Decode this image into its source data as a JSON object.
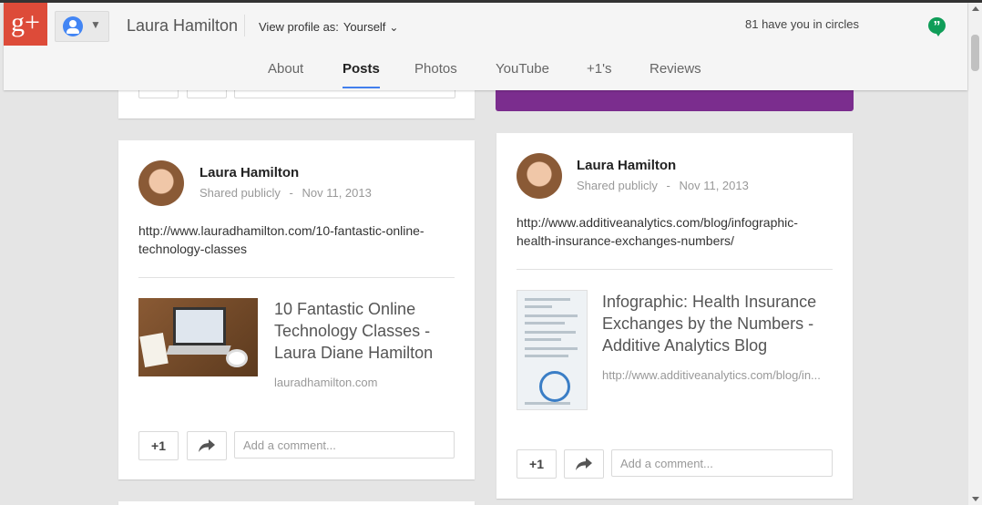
{
  "app": {
    "logo_text": "g+"
  },
  "header": {
    "profile_name": "Laura Hamilton",
    "view_profile_label": "View profile as:",
    "view_profile_value": "Yourself",
    "circles_text": "81 have you in circles"
  },
  "tabs": [
    {
      "label": "About"
    },
    {
      "label": "Posts",
      "active": true
    },
    {
      "label": "Photos"
    },
    {
      "label": "YouTube"
    },
    {
      "label": "+1's"
    },
    {
      "label": "Reviews"
    }
  ],
  "posts": [
    {
      "author": "Laura Hamilton",
      "visibility": "Shared publicly",
      "separator": "-",
      "date": "Nov 11, 2013",
      "url_line1": "http://www.lauradhamilton.com/10-fantastic-online-",
      "url_line2": "technology-classes",
      "link_title_line1": "10 Fantastic Online",
      "link_title_line2": "Technology Classes -",
      "link_title_line3": "Laura Diane Hamilton",
      "link_domain": "lauradhamilton.com",
      "plus_one": "+1",
      "comment_placeholder": "Add a comment..."
    },
    {
      "author": "Laura Hamilton",
      "visibility": "Shared publicly",
      "separator": "-",
      "date": "Nov 11, 2013",
      "url_line1": "http://www.additiveanalytics.com/blog/infographic-",
      "url_line2": "health-insurance-exchanges-numbers/",
      "link_title_line1": "Infographic: Health Insurance",
      "link_title_line2": "Exchanges by the Numbers -",
      "link_title_line3": "Additive Analytics Blog",
      "link_domain": "http://www.additiveanalytics.com/blog/in...",
      "plus_one": "+1",
      "comment_placeholder": "Add a comment..."
    }
  ],
  "colors": {
    "brand": "#dd4b39",
    "accent": "#427fed",
    "purple": "#7b2d8e",
    "hangouts": "#0f9d58"
  },
  "icons": [
    "google-plus-logo",
    "account-icon",
    "chevron-down-icon",
    "hangouts-icon",
    "share-icon"
  ]
}
